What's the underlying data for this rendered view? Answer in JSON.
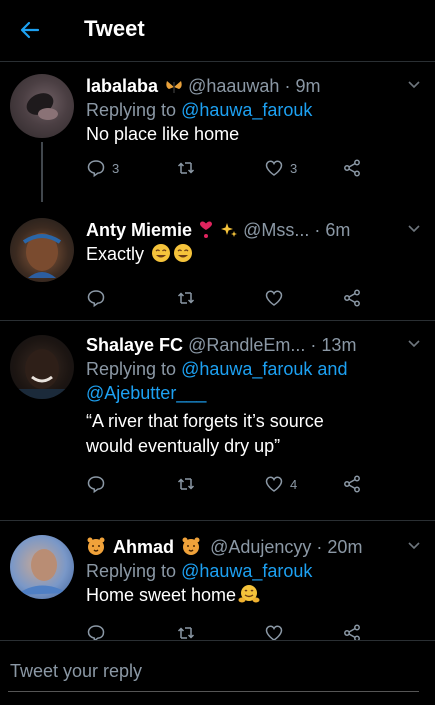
{
  "header": {
    "title": "Tweet",
    "back_icon": "arrow-left-icon",
    "accent": "#1da1f2"
  },
  "tweets": [
    {
      "name": "labalaba",
      "handle": "@haauwah",
      "dot": "·",
      "time": "9m",
      "reply_prefix": "Replying to ",
      "reply_to": "@hauwa_farouk",
      "text": "No place like home",
      "reply_count": "3",
      "like_count": "3"
    },
    {
      "name": "Anty Miemie",
      "handle": "@Mss...",
      "dot": "·",
      "time": "6m",
      "text": "Exactly"
    },
    {
      "name": "Shalaye FC",
      "handle": "@RandleEm...",
      "dot": "·",
      "time": "13m",
      "reply_prefix": "Replying to ",
      "reply_to": "@hauwa_farouk",
      "reply_and": " and",
      "reply_to2": "@Ajebutter___",
      "text_line1": "“A river that forgets it’s source",
      "text_line2": "would eventually dry up”",
      "like_count": "4"
    },
    {
      "name": "Ahmad",
      "handle": "@Adujencyy",
      "dot": "·",
      "time": "20m",
      "reply_prefix": "Replying to ",
      "reply_to": "@hauwa_farouk",
      "text": "Home sweet home"
    }
  ],
  "reply_bar": {
    "placeholder": "Tweet your reply"
  }
}
